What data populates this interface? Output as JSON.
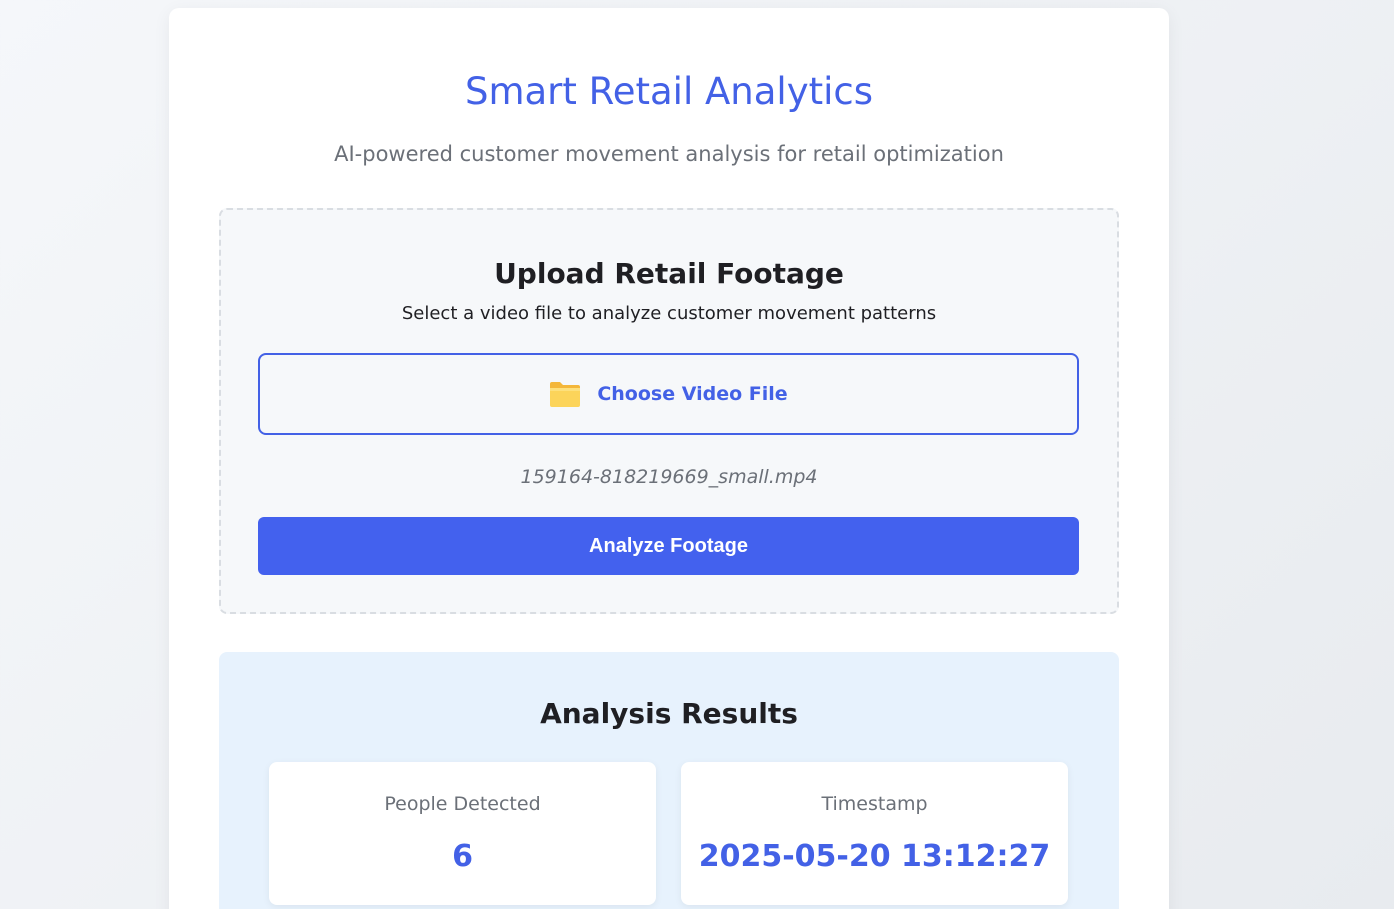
{
  "header": {
    "title": "Smart Retail Analytics",
    "subtitle": "AI-powered customer movement analysis for retail optimization"
  },
  "upload": {
    "heading": "Upload Retail Footage",
    "description": "Select a video file to analyze customer movement patterns",
    "choose_label": "Choose Video File",
    "choose_icon": "folder-icon",
    "selected_file": "159164-818219669_small.mp4",
    "analyze_label": "Analyze Footage"
  },
  "results": {
    "heading": "Analysis Results",
    "stats": [
      {
        "label": "People Detected",
        "value": "6"
      },
      {
        "label": "Timestamp",
        "value": "2025-05-20 13:12:27"
      }
    ]
  },
  "colors": {
    "accent": "#4361ee",
    "results_background": "#e7f2fd",
    "upload_background": "#f6f8fa"
  }
}
